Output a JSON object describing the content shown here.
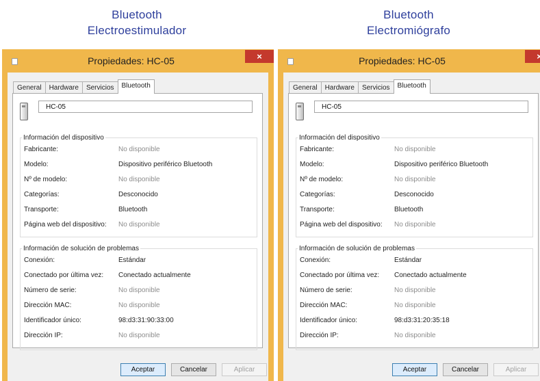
{
  "captions": {
    "left": {
      "line1": "Bluetooth",
      "line2": "Electroestimulador"
    },
    "right": {
      "line1": "Bluetooth",
      "line2": "Electromiógrafo"
    }
  },
  "colors": {
    "window_frame": "#f0b74b",
    "close_button": "#c4392d",
    "caption_text": "#2e3f9c"
  },
  "left": {
    "title": "Propiedades: HC-05",
    "close_glyph": "×",
    "tabs": [
      "General",
      "Hardware",
      "Servicios",
      "Bluetooth"
    ],
    "active_tab": "Bluetooth",
    "device_name": "HC-05",
    "device_group": {
      "title": "Información del dispositivo",
      "rows": [
        {
          "label": "Fabricante:",
          "value": "No disponible"
        },
        {
          "label": "Modelo:",
          "value": "Dispositivo periférico Bluetooth"
        },
        {
          "label": "Nº de modelo:",
          "value": "No disponible"
        },
        {
          "label": "Categorías:",
          "value": "Desconocido"
        },
        {
          "label": "Transporte:",
          "value": "Bluetooth"
        },
        {
          "label": "Página web del dispositivo:",
          "value": "No disponible"
        }
      ]
    },
    "troubleshoot_group": {
      "title": "Información de solución de problemas",
      "rows": [
        {
          "label": "Conexión:",
          "value": "Estándar"
        },
        {
          "label": "Conectado por última vez:",
          "value": "Conectado actualmente"
        },
        {
          "label": "Número de serie:",
          "value": "No disponible"
        },
        {
          "label": "Dirección MAC:",
          "value": "No disponible"
        },
        {
          "label": "Identificador único:",
          "value": "98:d3:31:90:33:00"
        },
        {
          "label": "Dirección IP:",
          "value": "No disponible"
        }
      ]
    },
    "buttons": {
      "ok": "Aceptar",
      "cancel": "Cancelar",
      "apply": "Aplicar"
    }
  },
  "right": {
    "title": "Propiedades: HC-05",
    "close_glyph": "×",
    "tabs": [
      "General",
      "Hardware",
      "Servicios",
      "Bluetooth"
    ],
    "active_tab": "Bluetooth",
    "device_name": "HC-05",
    "device_group": {
      "title": "Información del dispositivo",
      "rows": [
        {
          "label": "Fabricante:",
          "value": "No disponible"
        },
        {
          "label": "Modelo:",
          "value": "Dispositivo periférico Bluetooth"
        },
        {
          "label": "Nº de modelo:",
          "value": "No disponible"
        },
        {
          "label": "Categorías:",
          "value": "Desconocido"
        },
        {
          "label": "Transporte:",
          "value": "Bluetooth"
        },
        {
          "label": "Página web del dispositivo:",
          "value": "No disponible"
        }
      ]
    },
    "troubleshoot_group": {
      "title": "Información de solución de problemas",
      "rows": [
        {
          "label": "Conexión:",
          "value": "Estándar"
        },
        {
          "label": "Conectado por última vez:",
          "value": "Conectado actualmente"
        },
        {
          "label": "Número de serie:",
          "value": "No disponible"
        },
        {
          "label": "Dirección MAC:",
          "value": "No disponible"
        },
        {
          "label": "Identificador único:",
          "value": "98:d3:31:20:35:18"
        },
        {
          "label": "Dirección IP:",
          "value": "No disponible"
        }
      ]
    },
    "buttons": {
      "ok": "Aceptar",
      "cancel": "Cancelar",
      "apply": "Aplicar"
    }
  }
}
